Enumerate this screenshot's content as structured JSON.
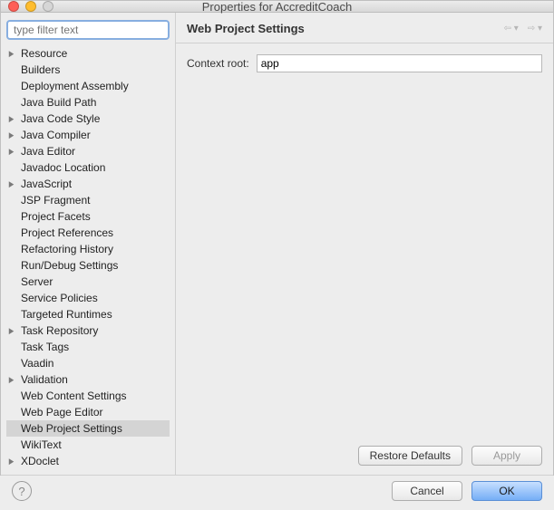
{
  "window": {
    "title": "Properties for AccreditCoach"
  },
  "traffic": {
    "close": "#ff5f57",
    "minimize": "#ffbd2e",
    "zoom": "#d6d6d6"
  },
  "sidebar": {
    "filter_placeholder": "type filter text",
    "items": [
      {
        "label": "Resource",
        "expandable": true
      },
      {
        "label": "Builders",
        "expandable": false
      },
      {
        "label": "Deployment Assembly",
        "expandable": false
      },
      {
        "label": "Java Build Path",
        "expandable": false
      },
      {
        "label": "Java Code Style",
        "expandable": true
      },
      {
        "label": "Java Compiler",
        "expandable": true
      },
      {
        "label": "Java Editor",
        "expandable": true
      },
      {
        "label": "Javadoc Location",
        "expandable": false
      },
      {
        "label": "JavaScript",
        "expandable": true
      },
      {
        "label": "JSP Fragment",
        "expandable": false
      },
      {
        "label": "Project Facets",
        "expandable": false
      },
      {
        "label": "Project References",
        "expandable": false
      },
      {
        "label": "Refactoring History",
        "expandable": false
      },
      {
        "label": "Run/Debug Settings",
        "expandable": false
      },
      {
        "label": "Server",
        "expandable": false
      },
      {
        "label": "Service Policies",
        "expandable": false
      },
      {
        "label": "Targeted Runtimes",
        "expandable": false
      },
      {
        "label": "Task Repository",
        "expandable": true
      },
      {
        "label": "Task Tags",
        "expandable": false
      },
      {
        "label": "Vaadin",
        "expandable": false
      },
      {
        "label": "Validation",
        "expandable": true
      },
      {
        "label": "Web Content Settings",
        "expandable": false
      },
      {
        "label": "Web Page Editor",
        "expandable": false
      },
      {
        "label": "Web Project Settings",
        "expandable": false,
        "selected": true
      },
      {
        "label": "WikiText",
        "expandable": false
      },
      {
        "label": "XDoclet",
        "expandable": true
      }
    ]
  },
  "main": {
    "heading": "Web Project Settings",
    "context_root_label": "Context root:",
    "context_root_value": "app",
    "restore_defaults": "Restore Defaults",
    "apply": "Apply"
  },
  "footer": {
    "cancel": "Cancel",
    "ok": "OK"
  }
}
